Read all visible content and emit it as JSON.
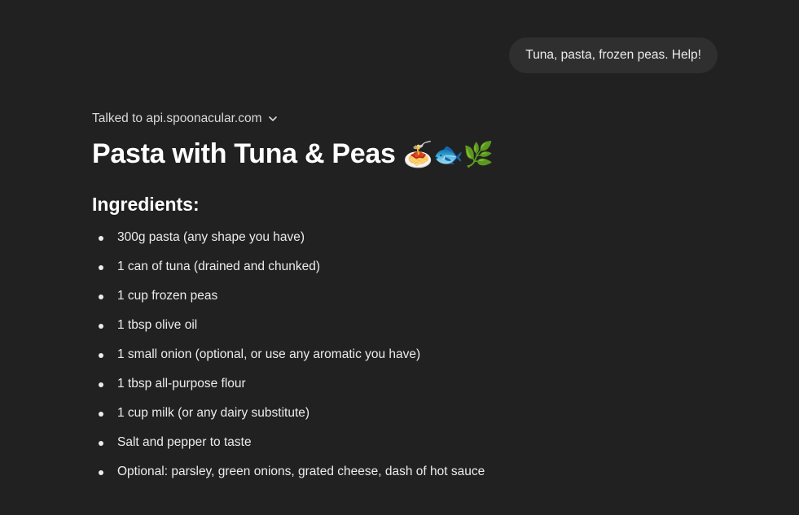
{
  "user_message": {
    "text": "Tuna, pasta, frozen peas. Help!"
  },
  "tool_call": {
    "label": "Talked to api.spoonacular.com",
    "icon": "chevron-down-icon"
  },
  "recipe": {
    "title": "Pasta with Tuna & Peas",
    "emojis": "🍝🐟🌿",
    "ingredients_heading": "Ingredients:",
    "ingredients": [
      "300g pasta (any shape you have)",
      "1 can of tuna (drained and chunked)",
      "1 cup frozen peas",
      "1 tbsp olive oil",
      "1 small onion (optional, or use any aromatic you have)",
      "1 tbsp all-purpose flour",
      "1 cup milk (or any dairy substitute)",
      "Salt and pepper to taste",
      "Optional: parsley, green onions, grated cheese, dash of hot sauce"
    ]
  },
  "colors": {
    "background": "#212121",
    "bubble": "#2f2f2f",
    "text": "#ececec",
    "heading": "#ffffff"
  }
}
